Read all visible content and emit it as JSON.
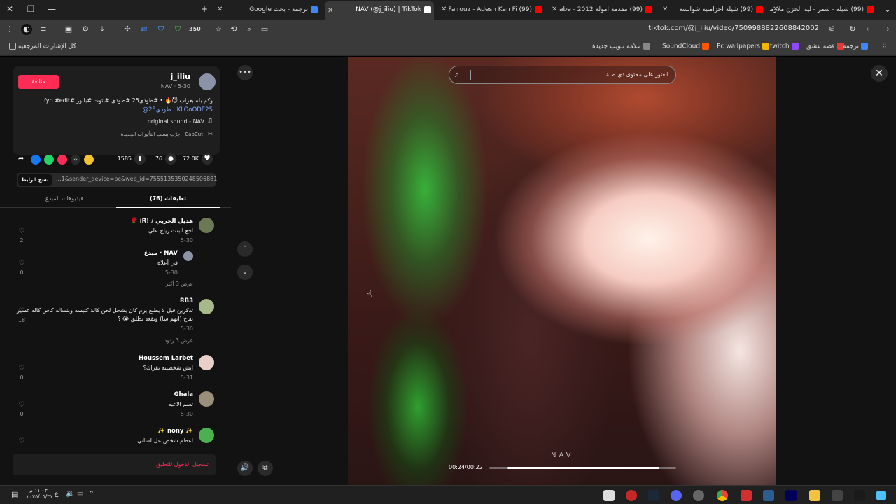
{
  "tabs": [
    {
      "title": "(99) شيله - شمر - ليه الحزن ملازمني",
      "fav": "#ff0000"
    },
    {
      "title": "(99) شيلة احزامنيه شوانشة",
      "fav": "#ff0000"
    },
    {
      "title": "(99) مقدمة امولة 2012 - abe",
      "fav": "#ff0000"
    },
    {
      "title": "(99) Fairouz - Adesh Kan Fi",
      "fav": "#ff0000"
    },
    {
      "title": "NAV (@j_iliu) | TikTok",
      "fav": "#111111"
    },
    {
      "title": "ترجمة - بحث Google",
      "fav": "#4285f4"
    }
  ],
  "browser": {
    "url": "tiktok.com/@j_iliu/video/7509988822608842002",
    "extension_badge": "350",
    "bookmarks": [
      {
        "label": "ترجمة",
        "color": "#4285f4"
      },
      {
        "label": "قصة عشق",
        "color": "#e53935"
      },
      {
        "label": "twitch",
        "color": "#9146ff"
      },
      {
        "label": "Pc wallpapers",
        "color": "#f4b400"
      },
      {
        "label": "SoundCloud",
        "color": "#ff5500"
      },
      {
        "label": "علامة تبويب جديدة",
        "color": "#888888"
      }
    ],
    "all_bookmarks": "كل الإشارات المرجعية"
  },
  "video_info": {
    "username": "j_iliu",
    "display": "NAV · 5-30",
    "follow_label": "متابعة",
    "caption_line1": "وكم بله بغراب 😈🔥 • #طودي25 #طودي #بتوت #بانور #fyp #edit",
    "caption_line2": "KLOoODE25 | طودي25@",
    "sound": "original sound - NAV",
    "capcut": "CapCut · جرّب بسبب التأثيرات الجديدة",
    "likes": "72.0K",
    "comments": "76",
    "saves": "1585",
    "link": "...1&sender_device=pc&web_id=7555135350248506881",
    "copy_link": "نسخ الرابط"
  },
  "panel_tabs": {
    "comments": "(76) تعليقات",
    "creator_videos": "فيديوهات المبدع"
  },
  "comments": [
    {
      "name": "هديل الحربي / !iR 🌹",
      "text": "اجع البنت رياح علي",
      "date": "5-30",
      "likes": "2",
      "avatar": "#6b7a55"
    },
    {
      "name": "NAV · مبدع",
      "text": "في أعلاه",
      "date": "5-30",
      "likes": "0",
      "avatar": "#8a93a8"
    },
    {
      "name": "RB3",
      "text": "تذكرين قبل لا يطلع يرم كان بشحل لحن كالة كثيسه وبنساله كاس كاله عسير",
      "text2": "تفاح (انهم سا) وتقعد تطلق 😭 ؟",
      "date": "5-30",
      "likes": "18",
      "avatar": "#a7b88a"
    },
    {
      "name": "Houssem Larbet",
      "text": "ايش شخصيته بقراك؟",
      "date": "5-31",
      "likes": "0",
      "avatar": "#e8d0c8"
    },
    {
      "name": "Ghala",
      "text": "تسم الاعبه",
      "date": "5-30",
      "likes": "0",
      "avatar": "#9a8f7a"
    },
    {
      "name": "✨ nony ✨",
      "text": "اعظم شخص عل لساني",
      "date": "",
      "likes": "",
      "avatar": "#4caf50"
    }
  ],
  "replies_more": [
    "عرض 3 أكثر",
    "عرض 3 ردود"
  ],
  "reply_label": "رد",
  "login_prompt": "تسجيل الدخول للتعليق",
  "video": {
    "search_placeholder": "العثور على محتوى ذي صلة",
    "time": "00:24/00:22",
    "watermark": "NAV",
    "progress": 0.9
  },
  "taskbar": {
    "time": "١١:٠٣ م",
    "date": "٢٠٢٥/٠٥/٣١",
    "lang": "ع"
  }
}
